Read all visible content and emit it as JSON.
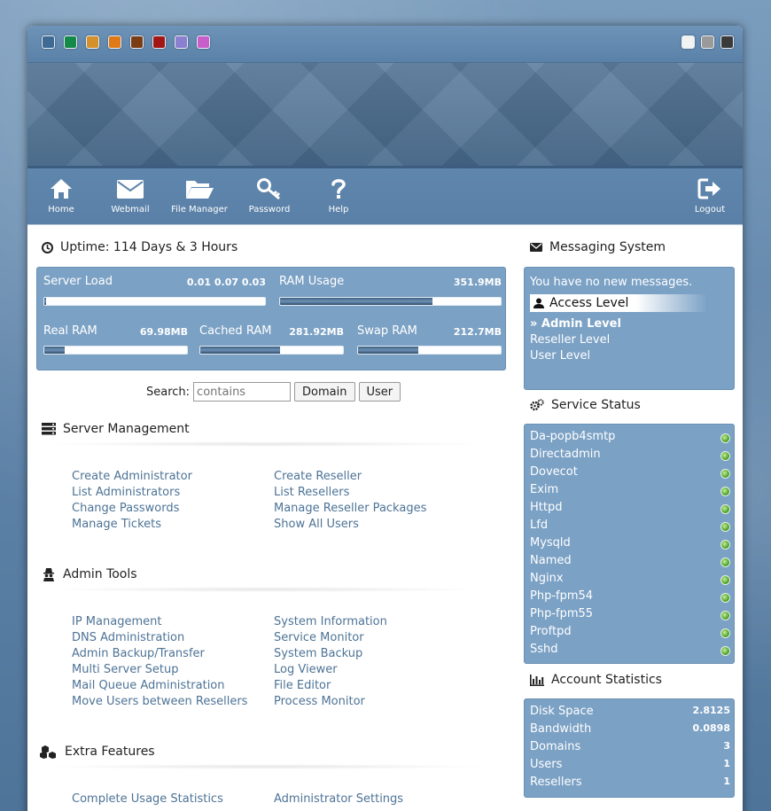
{
  "theme": {
    "swatches": [
      "#3f6a94",
      "#138a4a",
      "#d4902a",
      "#e07a18",
      "#7a3d14",
      "#a31616",
      "#8b7fd0",
      "#c85ec9"
    ],
    "layout_swatches": [
      "#f2f2f2",
      "#9a9a9a",
      "#3a3a3a"
    ],
    "panel_color": "#7ba1c5",
    "link_color": "#4d7396"
  },
  "nav": {
    "home": "Home",
    "webmail": "Webmail",
    "file_manager": "File Manager",
    "password": "Password",
    "help": "Help",
    "logout": "Logout"
  },
  "uptime": {
    "title": "Uptime: 114 Days & 3 Hours"
  },
  "gauges": {
    "server_load": {
      "label": "Server Load",
      "value": "0.01 0.07 0.03",
      "fill": 0.01
    },
    "ram_usage": {
      "label": "RAM Usage",
      "value": "351.9MB",
      "fill": 0.69
    },
    "real_ram": {
      "label": "Real RAM",
      "value": "69.98MB",
      "fill": 0.14
    },
    "cached_ram": {
      "label": "Cached RAM",
      "value": "281.92MB",
      "fill": 0.56
    },
    "swap_ram": {
      "label": "Swap RAM",
      "value": "212.7MB",
      "fill": 0.42
    }
  },
  "search": {
    "label": "Search:",
    "placeholder": "contains",
    "domain_button": "Domain",
    "user_button": "User"
  },
  "server_management": {
    "title": "Server Management",
    "left": [
      "Create Administrator",
      "List Administrators",
      "Change Passwords",
      "Manage Tickets"
    ],
    "right": [
      "Create Reseller",
      "List Resellers",
      "Manage Reseller Packages",
      "Show All Users"
    ]
  },
  "admin_tools": {
    "title": "Admin Tools",
    "left": [
      "IP Management",
      "DNS Administration",
      "Admin Backup/Transfer",
      "Multi Server Setup",
      "Mail Queue Administration",
      "Move Users between Resellers"
    ],
    "right": [
      "System Information",
      "Service Monitor",
      "System Backup",
      "Log Viewer",
      "File Editor",
      "Process Monitor"
    ]
  },
  "extra_features": {
    "title": "Extra Features",
    "left": [
      "Complete Usage Statistics"
    ],
    "right": [
      "Administrator Settings"
    ]
  },
  "messaging": {
    "title": "Messaging System",
    "message": "You have no new messages.",
    "access_title": "Access Level",
    "levels": [
      "» Admin Level",
      "Reseller Level",
      "User Level"
    ]
  },
  "service_status": {
    "title": "Service Status",
    "services": [
      "Da-popb4smtp",
      "Directadmin",
      "Dovecot",
      "Exim",
      "Httpd",
      "Lfd",
      "Mysqld",
      "Named",
      "Nginx",
      "Php-fpm54",
      "Php-fpm55",
      "Proftpd",
      "Sshd"
    ]
  },
  "account_statistics": {
    "title": "Account Statistics",
    "rows": [
      {
        "label": "Disk Space",
        "value": "2.8125"
      },
      {
        "label": "Bandwidth",
        "value": "0.0898"
      },
      {
        "label": "Domains",
        "value": "3"
      },
      {
        "label": "Users",
        "value": "1"
      },
      {
        "label": "Resellers",
        "value": "1"
      }
    ]
  }
}
